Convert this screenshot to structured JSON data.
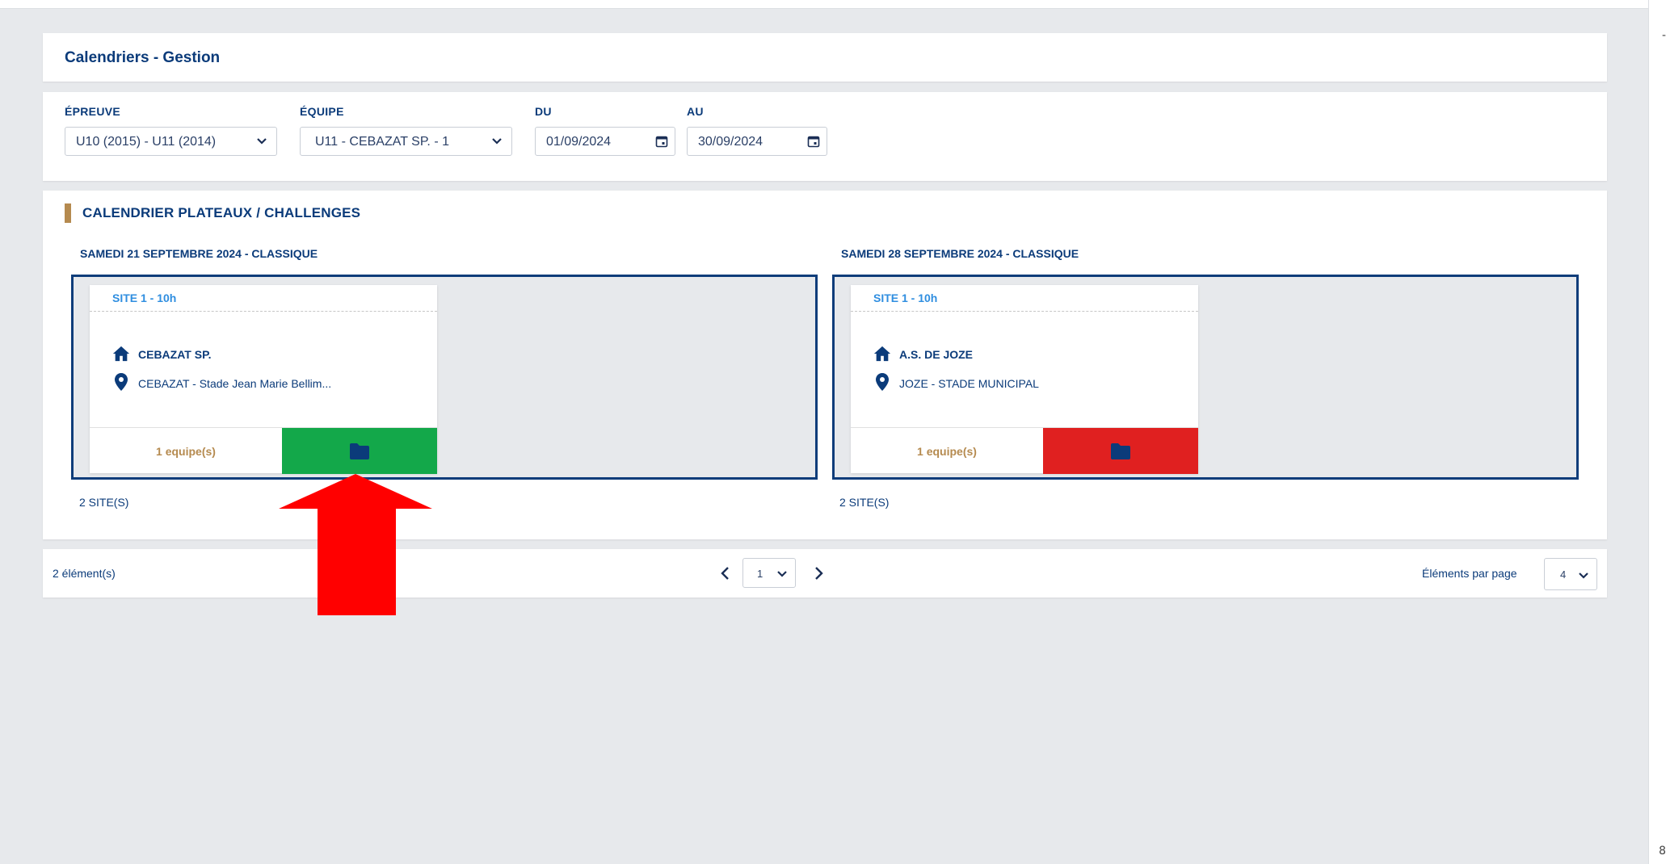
{
  "header": {
    "title": "Calendriers - Gestion"
  },
  "filters": {
    "epreuve": {
      "label": "ÉPREUVE",
      "value": "U10 (2015) - U11 (2014)"
    },
    "equipe": {
      "label": "ÉQUIPE",
      "value": "U11 - CEBAZAT SP. - 1"
    },
    "du": {
      "label": "DU",
      "value": "01/09/2024"
    },
    "au": {
      "label": "AU",
      "value": "30/09/2024"
    }
  },
  "section": {
    "title": "CALENDRIER PLATEAUX / CHALLENGES",
    "accent_color": "#b58a4f",
    "days": [
      {
        "title": "SAMEDI 21 SEPTEMBRE 2024 - CLASSIQUE",
        "site": {
          "header": "SITE 1 - 10h",
          "club": "CEBAZAT SP.",
          "location": "CEBAZAT - Stade Jean Marie Bellim...",
          "teams": "1 equipe(s)",
          "status_color": "#13a84a"
        },
        "sites_count": "2 SITE(S)"
      },
      {
        "title": "SAMEDI 28 SEPTEMBRE 2024 - CLASSIQUE",
        "site": {
          "header": "SITE 1 - 10h",
          "club": "A.S. DE JOZE",
          "location": "JOZE - STADE MUNICIPAL",
          "teams": "1 equipe(s)",
          "status_color": "#e02020"
        },
        "sites_count": "2 SITE(S)"
      }
    ]
  },
  "pagination": {
    "elements": "2 élément(s)",
    "page": "1",
    "per_page_label": "Éléments par page",
    "per_page": "4"
  },
  "icons": {
    "club": "home-icon",
    "location": "map-pin-icon",
    "folder": "folder-icon",
    "annotation": "red-arrow-up"
  }
}
